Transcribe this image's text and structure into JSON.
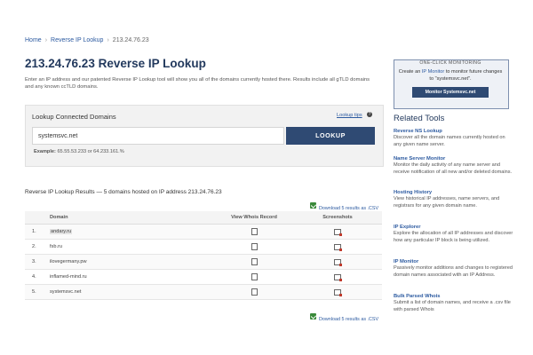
{
  "breadcrumb": {
    "home": "Home",
    "section": "Reverse IP Lookup",
    "current": "213.24.76.23"
  },
  "page_title": "213.24.76.23 Reverse IP Lookup",
  "intro": "Enter an IP address and our patented Reverse IP Lookup tool will show you all of the domains currently hosted there. Results include all gTLD domains and any known ccTLD domains.",
  "lookup": {
    "heading": "Lookup Connected Domains",
    "tips": "Lookup tips",
    "input_value": "systemsvc.net",
    "button": "LOOKUP",
    "example_label": "Example:",
    "example_text": "65.55.53.233 or 64.233.161.%"
  },
  "results": {
    "heading": "Reverse IP Lookup Results — 5 domains hosted on IP address 213.24.76.23",
    "csv_top": "Download 5 results as .CSV",
    "csv_bottom": "Download 5 results as .CSV",
    "columns": {
      "domain": "Domain",
      "whois": "View Whois Record",
      "shots": "Screenshots"
    },
    "rows": [
      {
        "n": "1.",
        "domain": "andary.ru"
      },
      {
        "n": "2.",
        "domain": "fsb.ru"
      },
      {
        "n": "3.",
        "domain": "ilovegermany.pw"
      },
      {
        "n": "4.",
        "domain": "inflamed-mind.ru"
      },
      {
        "n": "5.",
        "domain": "systemsvc.net"
      }
    ]
  },
  "promo": {
    "label": "ONE-CLICK MONITORING",
    "text_1": "Create an",
    "link": "IP Monitor",
    "text_2": "to monitor future changes to \"systemsvc.net\".",
    "button": "Monitor Systemsvc.net"
  },
  "related": {
    "title": "Related Tools",
    "tools": [
      {
        "name": "Reverse NS Lookup",
        "desc": "Discover all the domain names currently hosted on any given name server."
      },
      {
        "name": "Name Server Monitor",
        "desc": "Monitor the daily activity of any name server and receive notification of all new and/or deleted domains."
      },
      {
        "name": "Hosting History",
        "desc": "View historical IP addresses, name servers, and registrars for any given domain name."
      },
      {
        "name": "IP Explorer",
        "desc": "Explore the allocation of all IP addresses and discover how any particular IP block is being utilized."
      },
      {
        "name": "IP Monitor",
        "desc": "Passively monitor additions and changes to registered domain names associated with an IP Address."
      },
      {
        "name": "Bulk Parsed Whois",
        "desc": "Submit a list of domain names, and receive a .csv file with parsed Whois"
      }
    ]
  }
}
